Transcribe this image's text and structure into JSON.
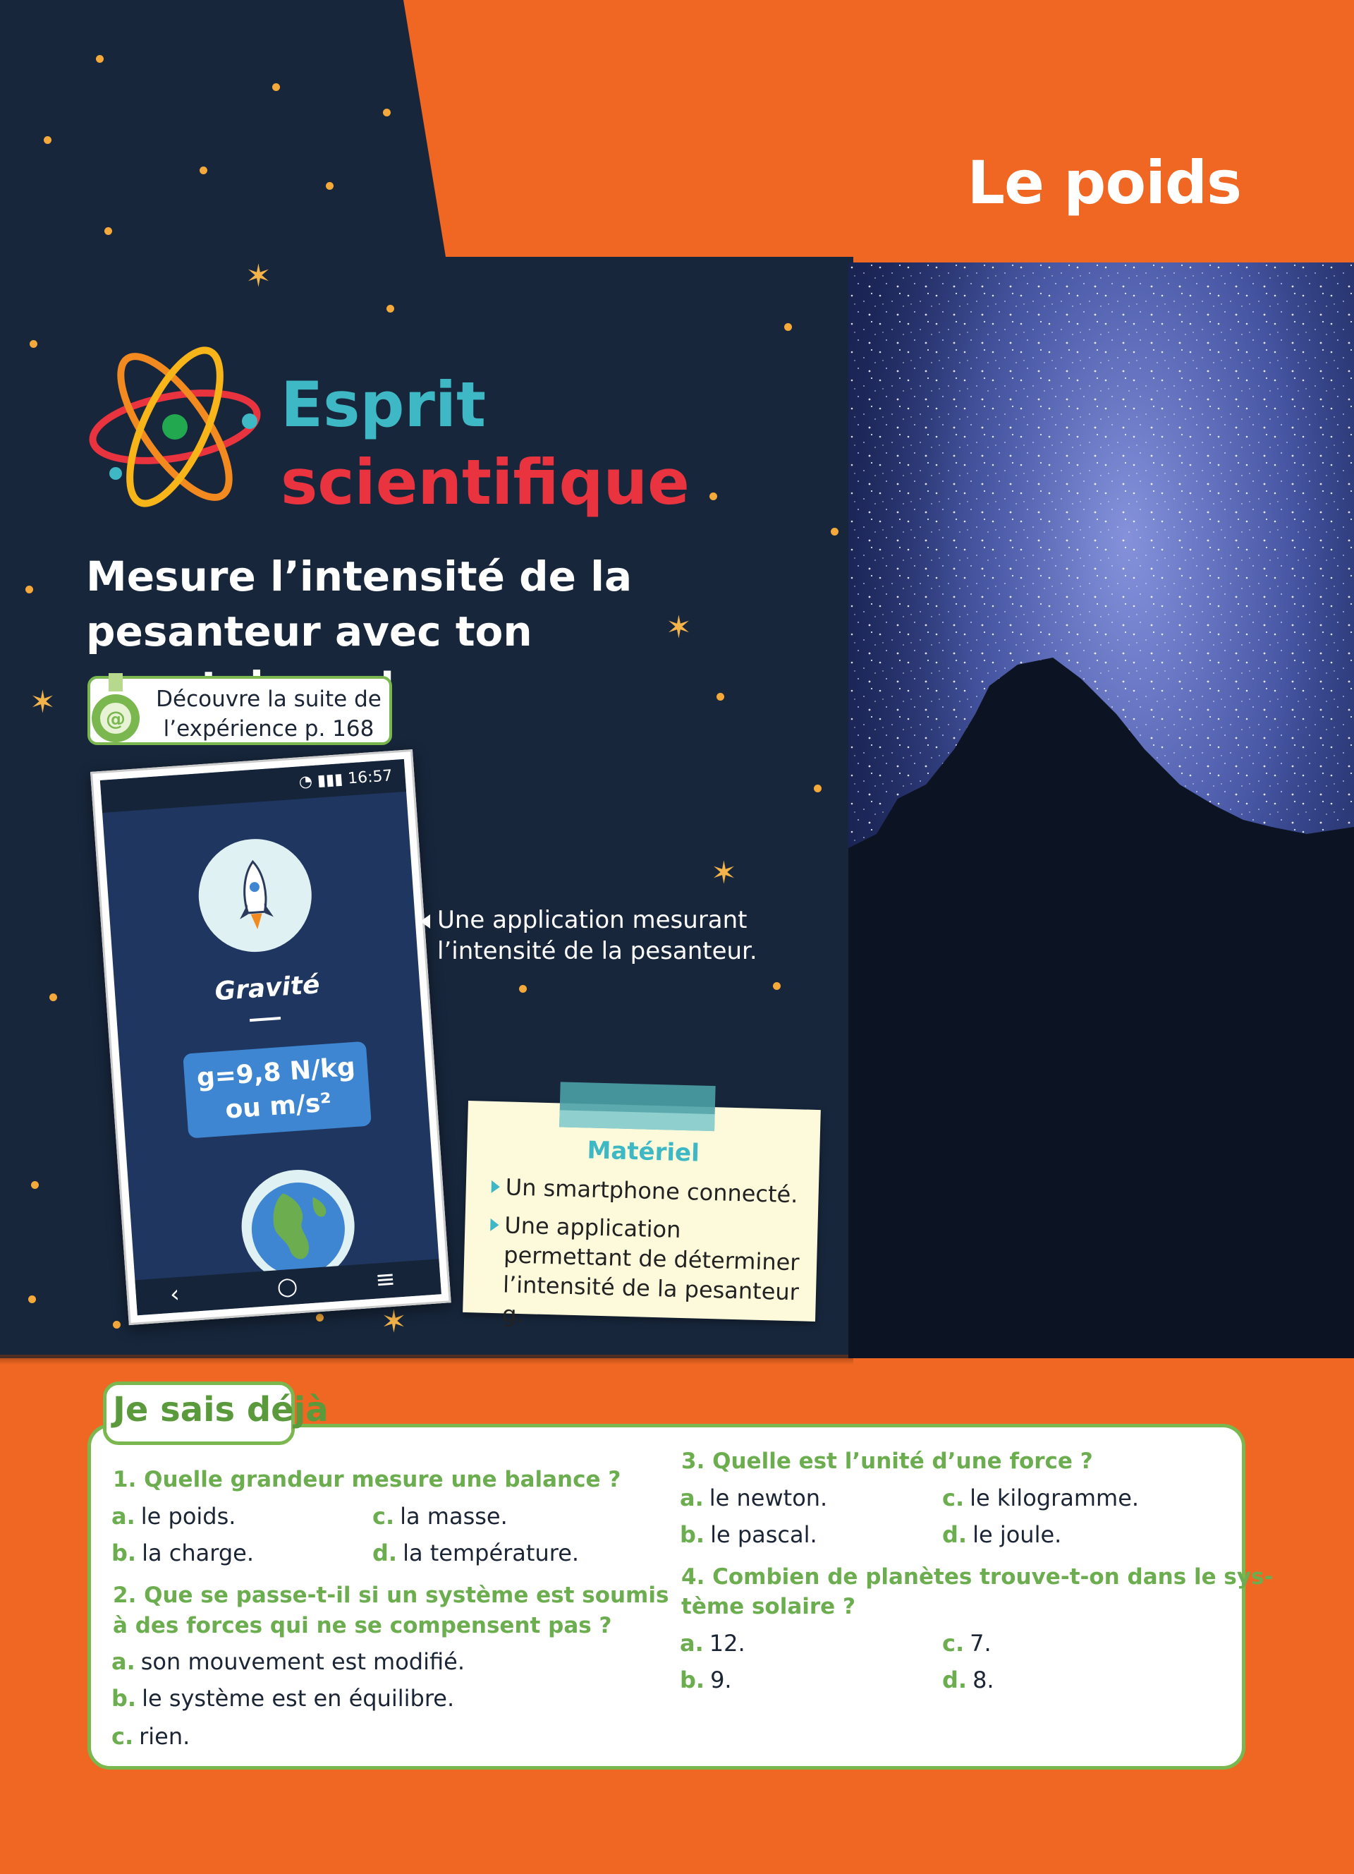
{
  "page": {
    "title": "Le poids"
  },
  "section": {
    "brand_line1": "Esprit",
    "brand_line2": "scientifique",
    "headline": "Mesure l’intensité de la pesanteur avec ton smartphone !",
    "discover": {
      "line1": "Découvre la suite de",
      "line2": "l’expérience p. 168"
    }
  },
  "phone": {
    "status_time": "16:57",
    "app_name": "Gravité",
    "value_line1": "g=9,8 N/kg",
    "value_line2": "ou m/s²",
    "nav_back": "‹",
    "nav_home": "○",
    "nav_menu": "≡"
  },
  "caption": {
    "line1": "Une application mesurant",
    "line2": "l’intensité de la pesanteur."
  },
  "materiel": {
    "title": "Matériel",
    "items": [
      "Un smartphone connecté.",
      "Une application permettant de déterminer l’intensité de la pesanteur g."
    ]
  },
  "quiz": {
    "title": "Je sais déjà",
    "questions": [
      {
        "q": "1. Quelle grandeur mesure une balance ?",
        "answers": [
          {
            "l": "a.",
            "t": "le poids."
          },
          {
            "l": "b.",
            "t": "la charge."
          },
          {
            "l": "c.",
            "t": "la masse."
          },
          {
            "l": "d.",
            "t": "la température."
          }
        ]
      },
      {
        "q_line1": "2. Que se passe-t-il si un système est soumis",
        "q_line2": "à des forces qui ne se compensent pas ?",
        "answers": [
          {
            "l": "a.",
            "t": "son mouvement est modifié."
          },
          {
            "l": "b.",
            "t": "le système est en équilibre."
          },
          {
            "l": "c.",
            "t": "rien."
          }
        ]
      },
      {
        "q": "3. Quelle est l’unité d’une force ?",
        "answers": [
          {
            "l": "a.",
            "t": "le newton."
          },
          {
            "l": "b.",
            "t": "le pascal."
          },
          {
            "l": "c.",
            "t": "le kilogramme."
          },
          {
            "l": "d.",
            "t": "le joule."
          }
        ]
      },
      {
        "q_line1": "4. Combien de planètes trouve-t-on dans le sys-",
        "q_line2": "tème solaire ?",
        "answers": [
          {
            "l": "a.",
            "t": "12."
          },
          {
            "l": "b.",
            "t": "9."
          },
          {
            "l": "c.",
            "t": "7."
          },
          {
            "l": "d.",
            "t": "8."
          }
        ]
      }
    ]
  },
  "colors": {
    "orange": "#ef6722",
    "navy": "#17263b",
    "green": "#7ab84f",
    "teal": "#3db8c4",
    "red": "#e9333e"
  }
}
